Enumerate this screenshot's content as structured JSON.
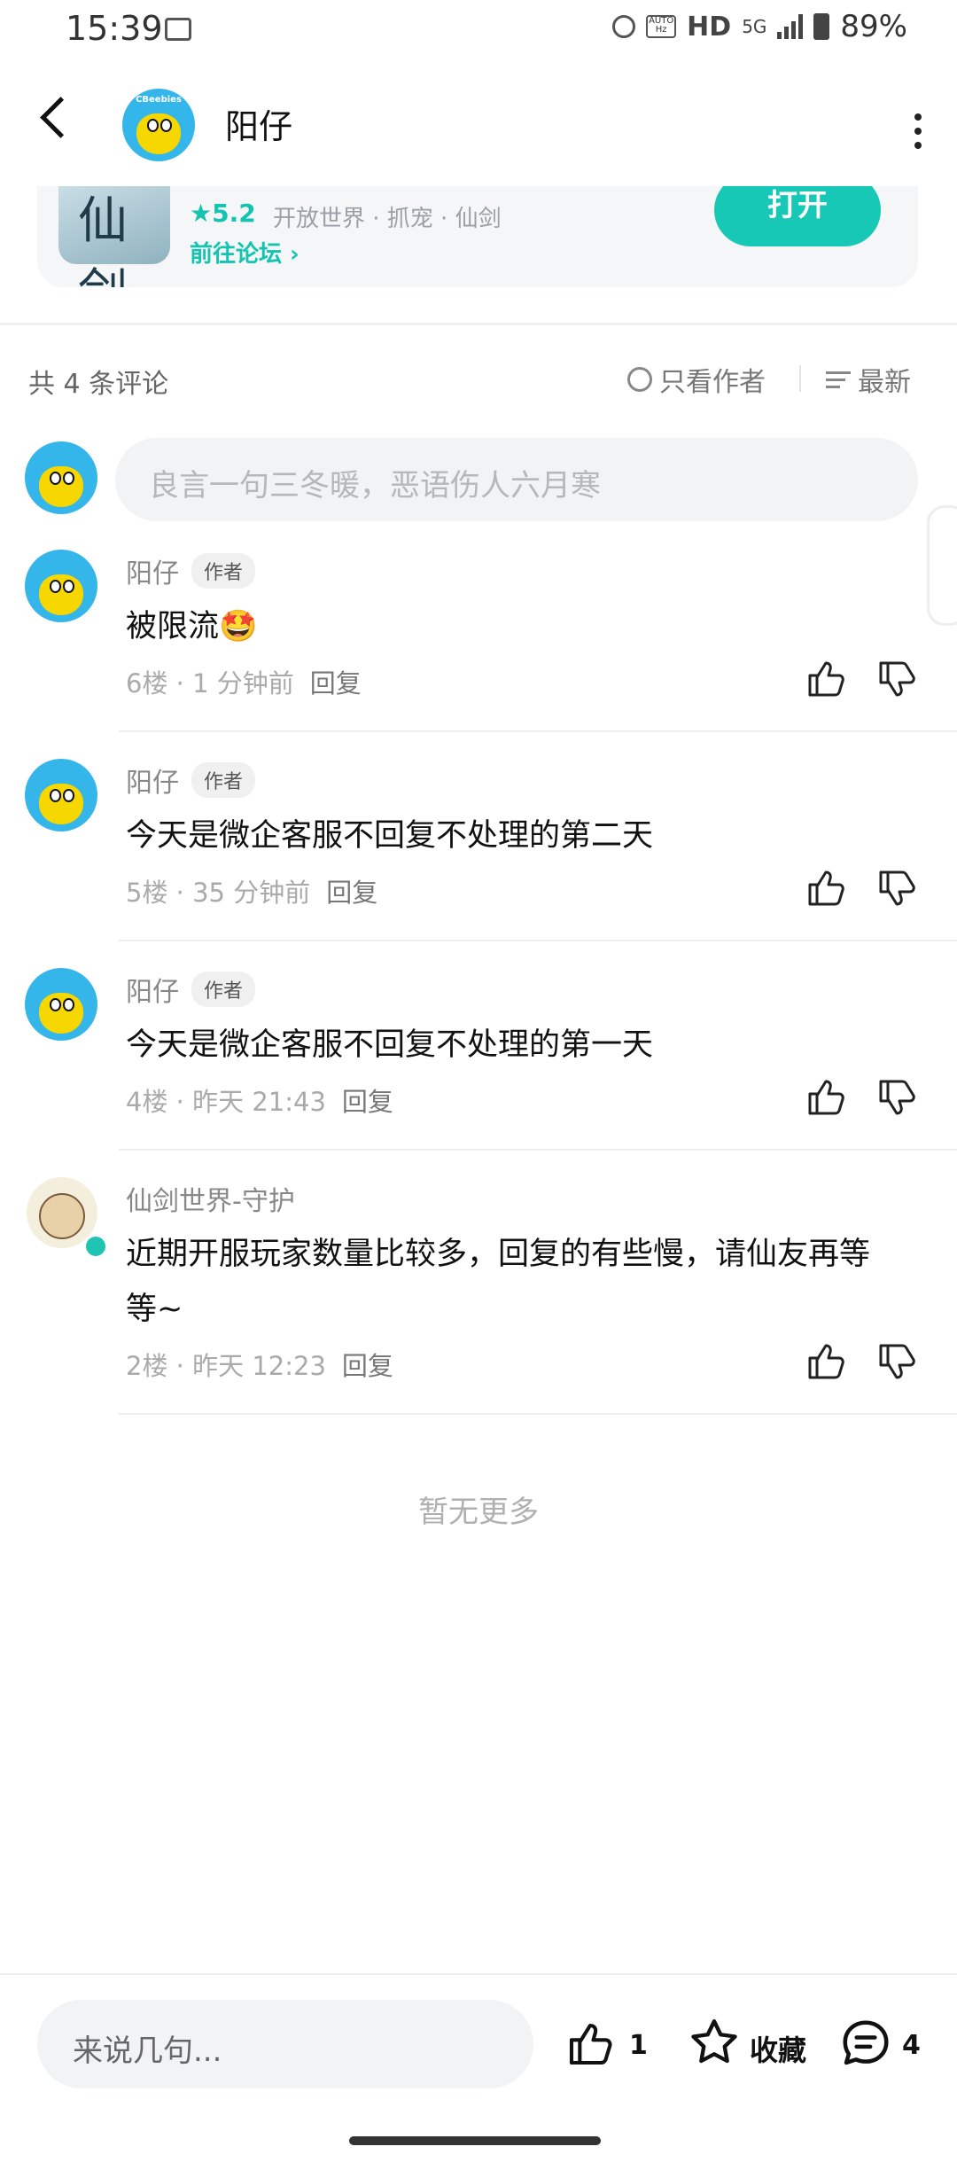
{
  "status_bar": {
    "time": "15:39",
    "hd": "HD",
    "network": "5G",
    "battery": "89%"
  },
  "header": {
    "title": "阳仔",
    "avatar_text": "CBeebies"
  },
  "app_card": {
    "icon_text": "仙剑",
    "rating": "★5.2",
    "tags": "开放世界 · 抓宠 · 仙剑",
    "forum_link": "前往论坛 ›",
    "open_button": "打开"
  },
  "comments_header": {
    "count": "共 4 条评论",
    "only_author": "只看作者",
    "sort": "最新"
  },
  "comment_input": {
    "placeholder": "良言一句三冬暖，恶语伤人六月寒"
  },
  "comments": [
    {
      "name": "阳仔",
      "badge": "作者",
      "text": "被限流🤩",
      "meta": "6楼 · 1 分钟前",
      "reply": "回复"
    },
    {
      "name": "阳仔",
      "badge": "作者",
      "text": "今天是微企客服不回复不处理的第二天",
      "meta": "5楼 · 35 分钟前",
      "reply": "回复"
    },
    {
      "name": "阳仔",
      "badge": "作者",
      "text": "今天是微企客服不回复不处理的第一天",
      "meta": "4楼 · 昨天 21:43",
      "reply": "回复"
    },
    {
      "name": "仙剑世界-守护",
      "badge": "",
      "text_line1": "近期开服玩家数量比较多，回复的有些慢，请仙友再等",
      "text_line2": "等~",
      "meta": "2楼 · 昨天 12:23",
      "reply": "回复"
    }
  ],
  "no_more": "暂无更多",
  "bottom_bar": {
    "placeholder": "来说几句...",
    "like_count": "1",
    "favorite_label": "收藏",
    "comment_count": "4"
  },
  "colors": {
    "accent": "#17c8b6",
    "avatar_bg": "#35b6ea",
    "avatar_yellow": "#f7d700"
  },
  "icons": [
    "back-icon",
    "more-icon",
    "alarm-icon",
    "image-icon",
    "signal-icon",
    "battery-icon",
    "thumbs-up-icon",
    "thumbs-down-icon",
    "star-icon",
    "comment-icon",
    "sort-icon",
    "circle-icon",
    "verified-icon"
  ]
}
